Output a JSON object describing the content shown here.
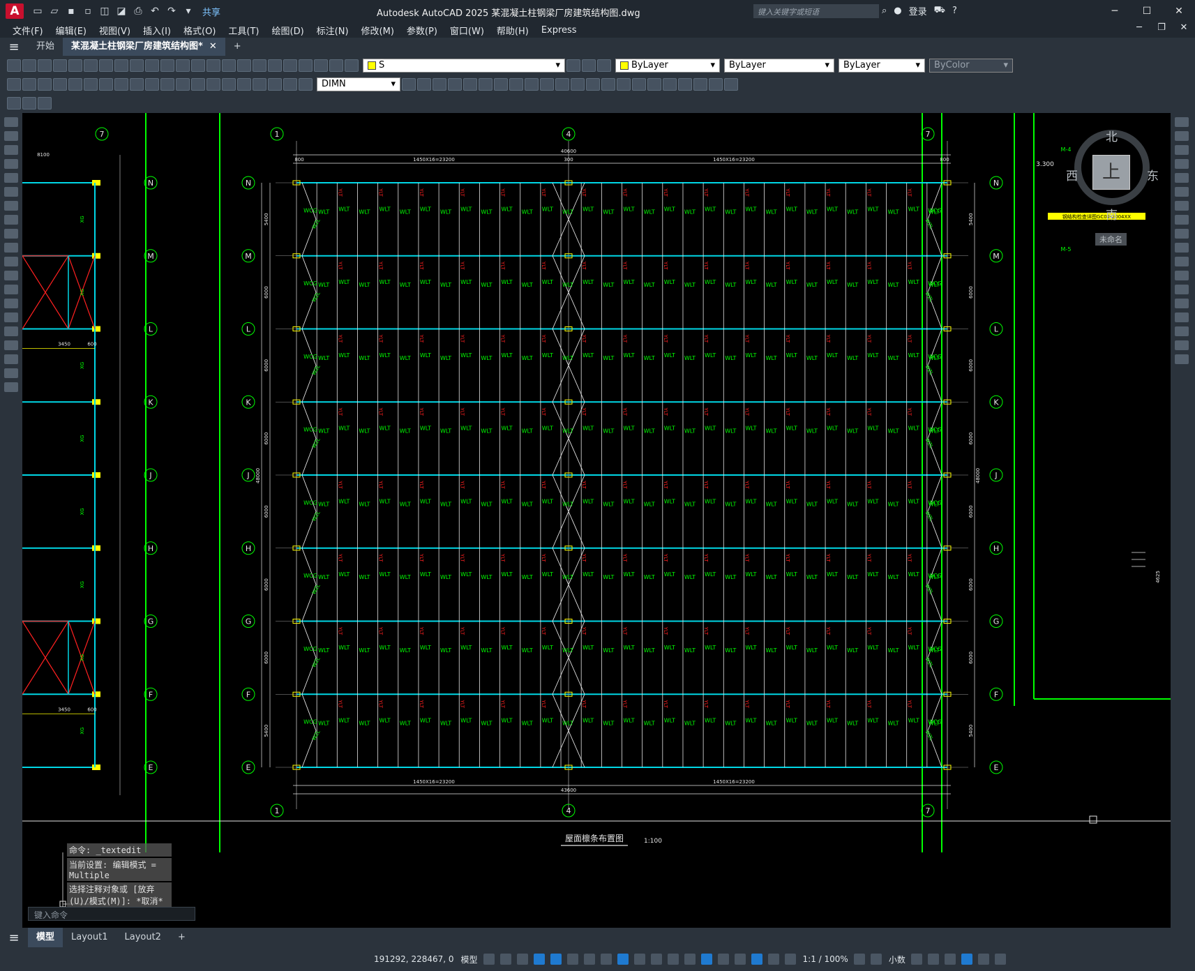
{
  "app": {
    "logo": "A",
    "share": "共享",
    "window_title": "Autodesk AutoCAD 2025    某混凝土柱钢梁厂房建筑结构图.dwg",
    "search_placeholder": "键入关键字或短语",
    "login": "登录"
  },
  "menu": [
    "文件(F)",
    "编辑(E)",
    "视图(V)",
    "插入(I)",
    "格式(O)",
    "工具(T)",
    "绘图(D)",
    "标注(N)",
    "修改(M)",
    "参数(P)",
    "窗口(W)",
    "帮助(H)",
    "Express"
  ],
  "doc_tabs": {
    "start": "开始",
    "active": "某混凝土柱钢梁厂房建筑结构图*",
    "close": "✕",
    "add": "+"
  },
  "props": {
    "layer": "S",
    "color": "ByLayer",
    "linetype": "ByLayer",
    "lineweight": "ByLayer",
    "plotstyle": "ByColor",
    "dimstyle": "DIMN"
  },
  "viewcube": {
    "north": "北",
    "south": "南",
    "east": "东",
    "west": "西",
    "face": "上",
    "wcs": "未命名"
  },
  "drawing": {
    "axis_top": [
      "1",
      "4",
      "7"
    ],
    "axis_left": [
      "N",
      "M",
      "L",
      "K",
      "J",
      "H",
      "G",
      "F",
      "E"
    ],
    "left_axis_top": "7",
    "dim_total": "40600",
    "dim_half": "1450X16=23200",
    "dim_edge": "800",
    "dim_mid": "300",
    "dim_bottom_total": "43600",
    "dim_5400": "5400",
    "dim_6000": "6000",
    "dim_left_total": "48000",
    "dim_left_8100": "8100",
    "dim_left_3450": "3450",
    "dim_left_600": "600",
    "label_wlt": "WLT",
    "label_wcg": "WCG",
    "label_ylt": "YLT",
    "label_wzl": "WZL",
    "label_xg": "XG",
    "label_gl": "GL",
    "label_3300": "3.300",
    "label_m4": "M-4",
    "label_m5": "M-5",
    "right_note": "钢结构检查详图GC02-2004ⅩⅩ",
    "right_dim": "4625",
    "title": "屋面檩条布置图",
    "scale": "1:100"
  },
  "command": {
    "line1": "命令: _textedit",
    "line2": "当前设置: 编辑模式 = Multiple",
    "line3": "选择注释对象或 [放弃(U)/模式(M)]: *取消*",
    "input_placeholder": "键入命令"
  },
  "layout_tabs": [
    "模型",
    "Layout1",
    "Layout2"
  ],
  "status": {
    "coords": "191292, 228467, 0",
    "space": "模型",
    "scale": "1:1 / 100%",
    "units": "小数"
  },
  "colors": {
    "cyan": "#00d7e6",
    "green": "#00ff00",
    "red": "#ff2020",
    "white": "#e6e6e6",
    "yellow": "#ffff00",
    "gray": "#9a9a9a"
  }
}
